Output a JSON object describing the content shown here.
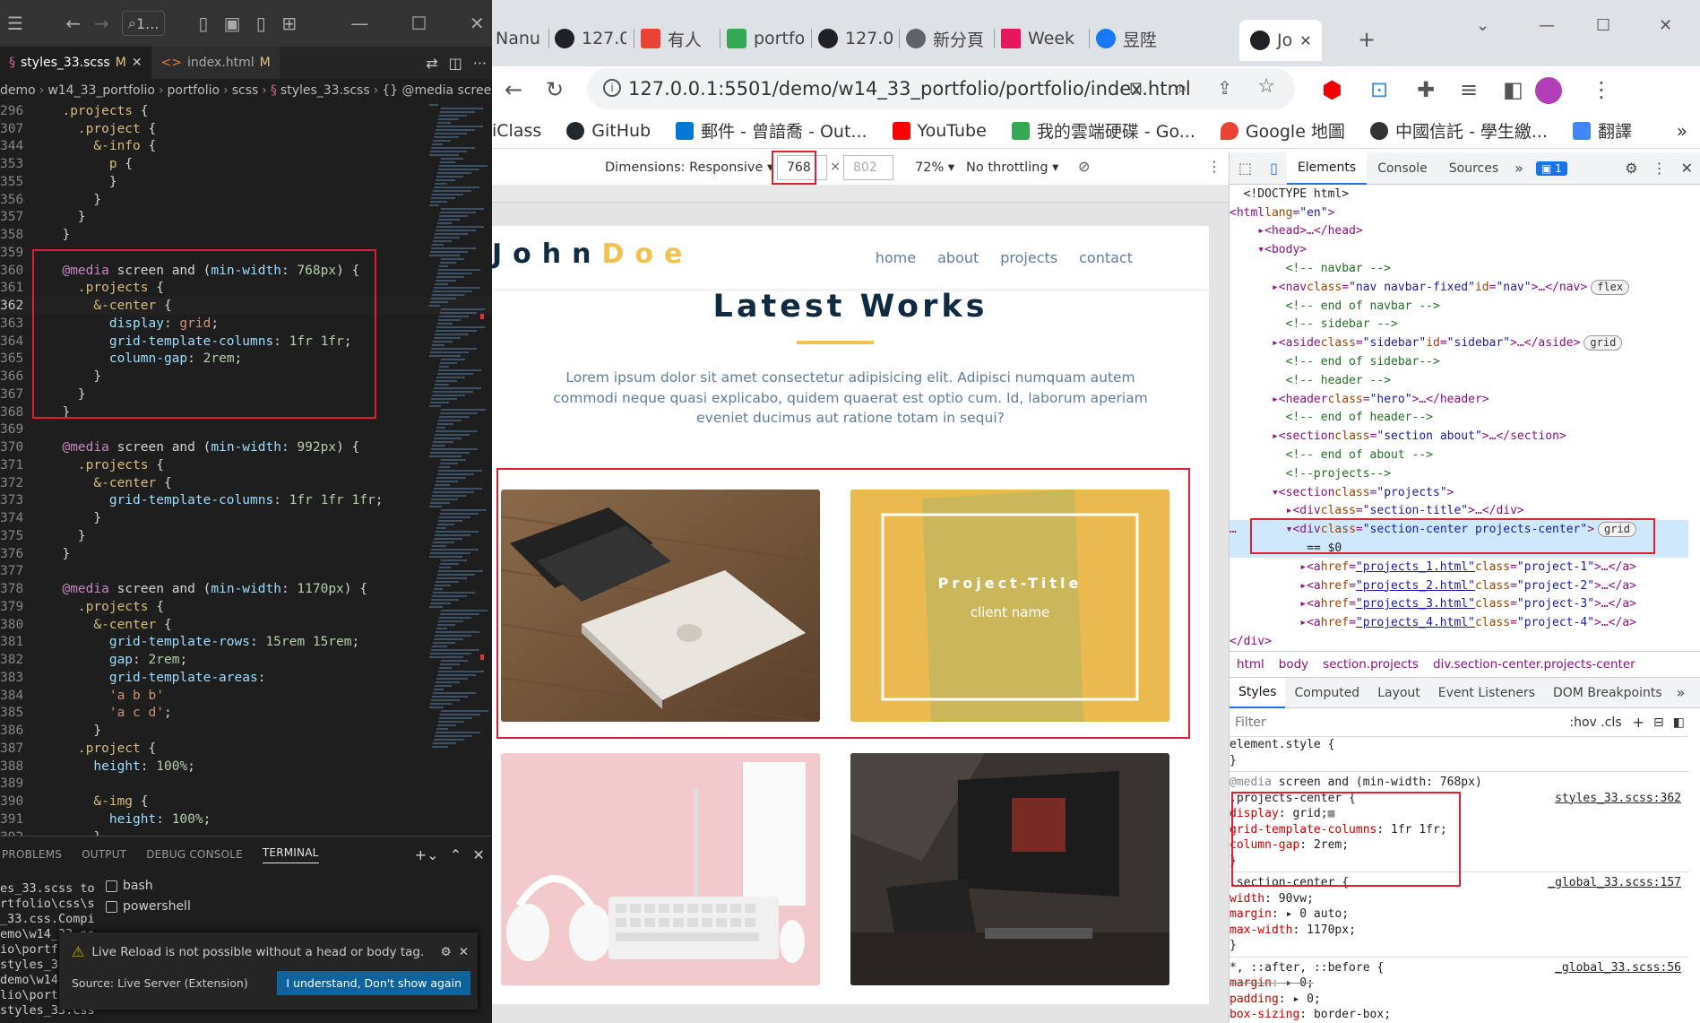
{
  "vscode": {
    "search_label": "1...",
    "tabs": [
      {
        "name": "styles_33.scss",
        "status": "M"
      },
      {
        "name": "index.html",
        "status": "M"
      }
    ],
    "breadcrumbs": [
      "demo",
      "w14_33_portfolio",
      "portfolio",
      "scss",
      "styles_33.scss",
      "{} @media screen and (m"
    ],
    "lines": [
      {
        "n": "296",
        "t": "  .projects {"
      },
      {
        "n": "307",
        "t": "    .project {"
      },
      {
        "n": "344",
        "t": "      &-info {"
      },
      {
        "n": "353",
        "t": "        p {"
      },
      {
        "n": "355",
        "t": "        }"
      },
      {
        "n": "356",
        "t": "      }"
      },
      {
        "n": "357",
        "t": "    }"
      },
      {
        "n": "358",
        "t": "  }"
      },
      {
        "n": "359",
        "t": ""
      },
      {
        "n": "360",
        "t": "  @media screen and (min-width: 768px) {"
      },
      {
        "n": "361",
        "t": "    .projects {"
      },
      {
        "n": "362",
        "t": "      &-center {"
      },
      {
        "n": "363",
        "t": "        display: grid;"
      },
      {
        "n": "364",
        "t": "        grid-template-columns: 1fr 1fr;"
      },
      {
        "n": "365",
        "t": "        column-gap: 2rem;"
      },
      {
        "n": "366",
        "t": "      }"
      },
      {
        "n": "367",
        "t": "    }"
      },
      {
        "n": "368",
        "t": "  }"
      },
      {
        "n": "369",
        "t": ""
      },
      {
        "n": "370",
        "t": "  @media screen and (min-width: 992px) {"
      },
      {
        "n": "371",
        "t": "    .projects {"
      },
      {
        "n": "372",
        "t": "      &-center {"
      },
      {
        "n": "373",
        "t": "        grid-template-columns: 1fr 1fr 1fr;"
      },
      {
        "n": "374",
        "t": "      }"
      },
      {
        "n": "375",
        "t": "    }"
      },
      {
        "n": "376",
        "t": "  }"
      },
      {
        "n": "377",
        "t": ""
      },
      {
        "n": "378",
        "t": "  @media screen and (min-width: 1170px) {"
      },
      {
        "n": "379",
        "t": "    .projects {"
      },
      {
        "n": "380",
        "t": "      &-center {"
      },
      {
        "n": "381",
        "t": "        grid-template-rows: 15rem 15rem;"
      },
      {
        "n": "382",
        "t": "        gap: 2rem;"
      },
      {
        "n": "383",
        "t": "        grid-template-areas:"
      },
      {
        "n": "384",
        "t": "        'a b b'"
      },
      {
        "n": "385",
        "t": "        'a c d';"
      },
      {
        "n": "386",
        "t": "      }"
      },
      {
        "n": "387",
        "t": "    .project {"
      },
      {
        "n": "388",
        "t": "      height: 100%;"
      },
      {
        "n": "389",
        "t": ""
      },
      {
        "n": "390",
        "t": "      &-img {"
      },
      {
        "n": "391",
        "t": "        height: 100%;"
      },
      {
        "n": "392",
        "t": "      }"
      }
    ],
    "panel_tabs": [
      "PROBLEMS",
      "OUTPUT",
      "DEBUG CONSOLE",
      "TERMINAL"
    ],
    "terminal_output": "es_33.scss to\nrtfolio\\css\\s\n_33.css.Compi\nemo\\w14_33_po\nio\\portf\nstyles_3\ndemo\\w14\nlio\\port\nstyles_33.css",
    "terminals": [
      "bash",
      "powershell"
    ],
    "toast": {
      "message": "Live Reload is not possible without a head or body tag.",
      "source": "Source: Live Server (Extension)",
      "button": "I understand, Don't show again"
    }
  },
  "browser": {
    "tabs": [
      {
        "label": "Nanu",
        "color": "#ffffff"
      },
      {
        "label": "127.0",
        "color": "#202124"
      },
      {
        "label": "有人",
        "color": "#ea4335"
      },
      {
        "label": "portfo",
        "color": "#34a853"
      },
      {
        "label": "127.0",
        "color": "#202124"
      },
      {
        "label": "新分頁",
        "color": "#5f6368"
      },
      {
        "label": "Week",
        "color": "#e8175d"
      },
      {
        "label": "昱陞",
        "color": "#1877f2"
      },
      {
        "label": "Jo",
        "color": "#202124"
      }
    ],
    "url": "127.0.0.1:5501/demo/w14_33_portfolio/portfolio/index.html",
    "bookmarks": [
      "iClass",
      "GitHub",
      "郵件 - 曾諳喬 - Out...",
      "YouTube",
      "我的雲端硬碟 - Go...",
      "Google 地圖",
      "中國信託 - 學生繳...",
      "翻譯"
    ],
    "bookmark_colors": [
      "#ffffff",
      "#24292e",
      "#0078d4",
      "#ff0000",
      "#34a853",
      "#ea4335",
      "#333333",
      "#4285f4"
    ],
    "device": {
      "dimensions_label": "Dimensions: Responsive",
      "width": "768",
      "height_placeholder": "802",
      "zoom": "72%",
      "throttle": "No throttling"
    }
  },
  "site": {
    "logo_first": "John",
    "logo_last": "Doe",
    "nav": [
      "home",
      "about",
      "projects",
      "contact"
    ],
    "title": "Latest Works",
    "text": "Lorem ipsum dolor sit amet consectetur adipisicing elit. Adipisci numquam autem commodi neque quasi explicabo, quidem quaerat est optio cum. Id, laborum aperiam eveniet ducimus aut ratione totam in sequi?",
    "card_title": "Project-Title",
    "card_client": "client name"
  },
  "devtools": {
    "tabs": [
      "Elements",
      "Console",
      "Sources"
    ],
    "issues_count": "1",
    "crumbs": [
      "html",
      "body",
      "section.projects",
      "div.section-center.projects-center"
    ],
    "subtabs": [
      "Styles",
      "Computed",
      "Layout",
      "Event Listeners",
      "DOM Breakpoints"
    ],
    "filter_placeholder": "Filter",
    "filter_tools": ":hov .cls",
    "styles": {
      "element_style": "element.style {",
      "close": "}",
      "mq_label": "@media",
      "mq_rest": " screen and (min-width: 768px)",
      "sel1": ".projects-center {",
      "src1": "styles_33.scss:362",
      "p1": [
        [
          "display",
          "grid;"
        ],
        [
          "grid-template-columns",
          "1fr 1fr;"
        ],
        [
          "column-gap",
          "2rem;"
        ]
      ],
      "sel2": ".section-center {",
      "src2": "_global_33.scss:157",
      "p2": [
        [
          "width",
          "90vw;"
        ],
        [
          "margin",
          "▸ 0 auto;"
        ],
        [
          "max-width",
          "1170px;"
        ]
      ],
      "sel3": "*, ::after, ::before {",
      "src3": "_global_33.scss:56",
      "p3": [
        [
          "margin",
          "▸ 0;"
        ],
        [
          "padding",
          "▸ 0;"
        ],
        [
          "box-sizing",
          "border-box;"
        ]
      ]
    }
  }
}
